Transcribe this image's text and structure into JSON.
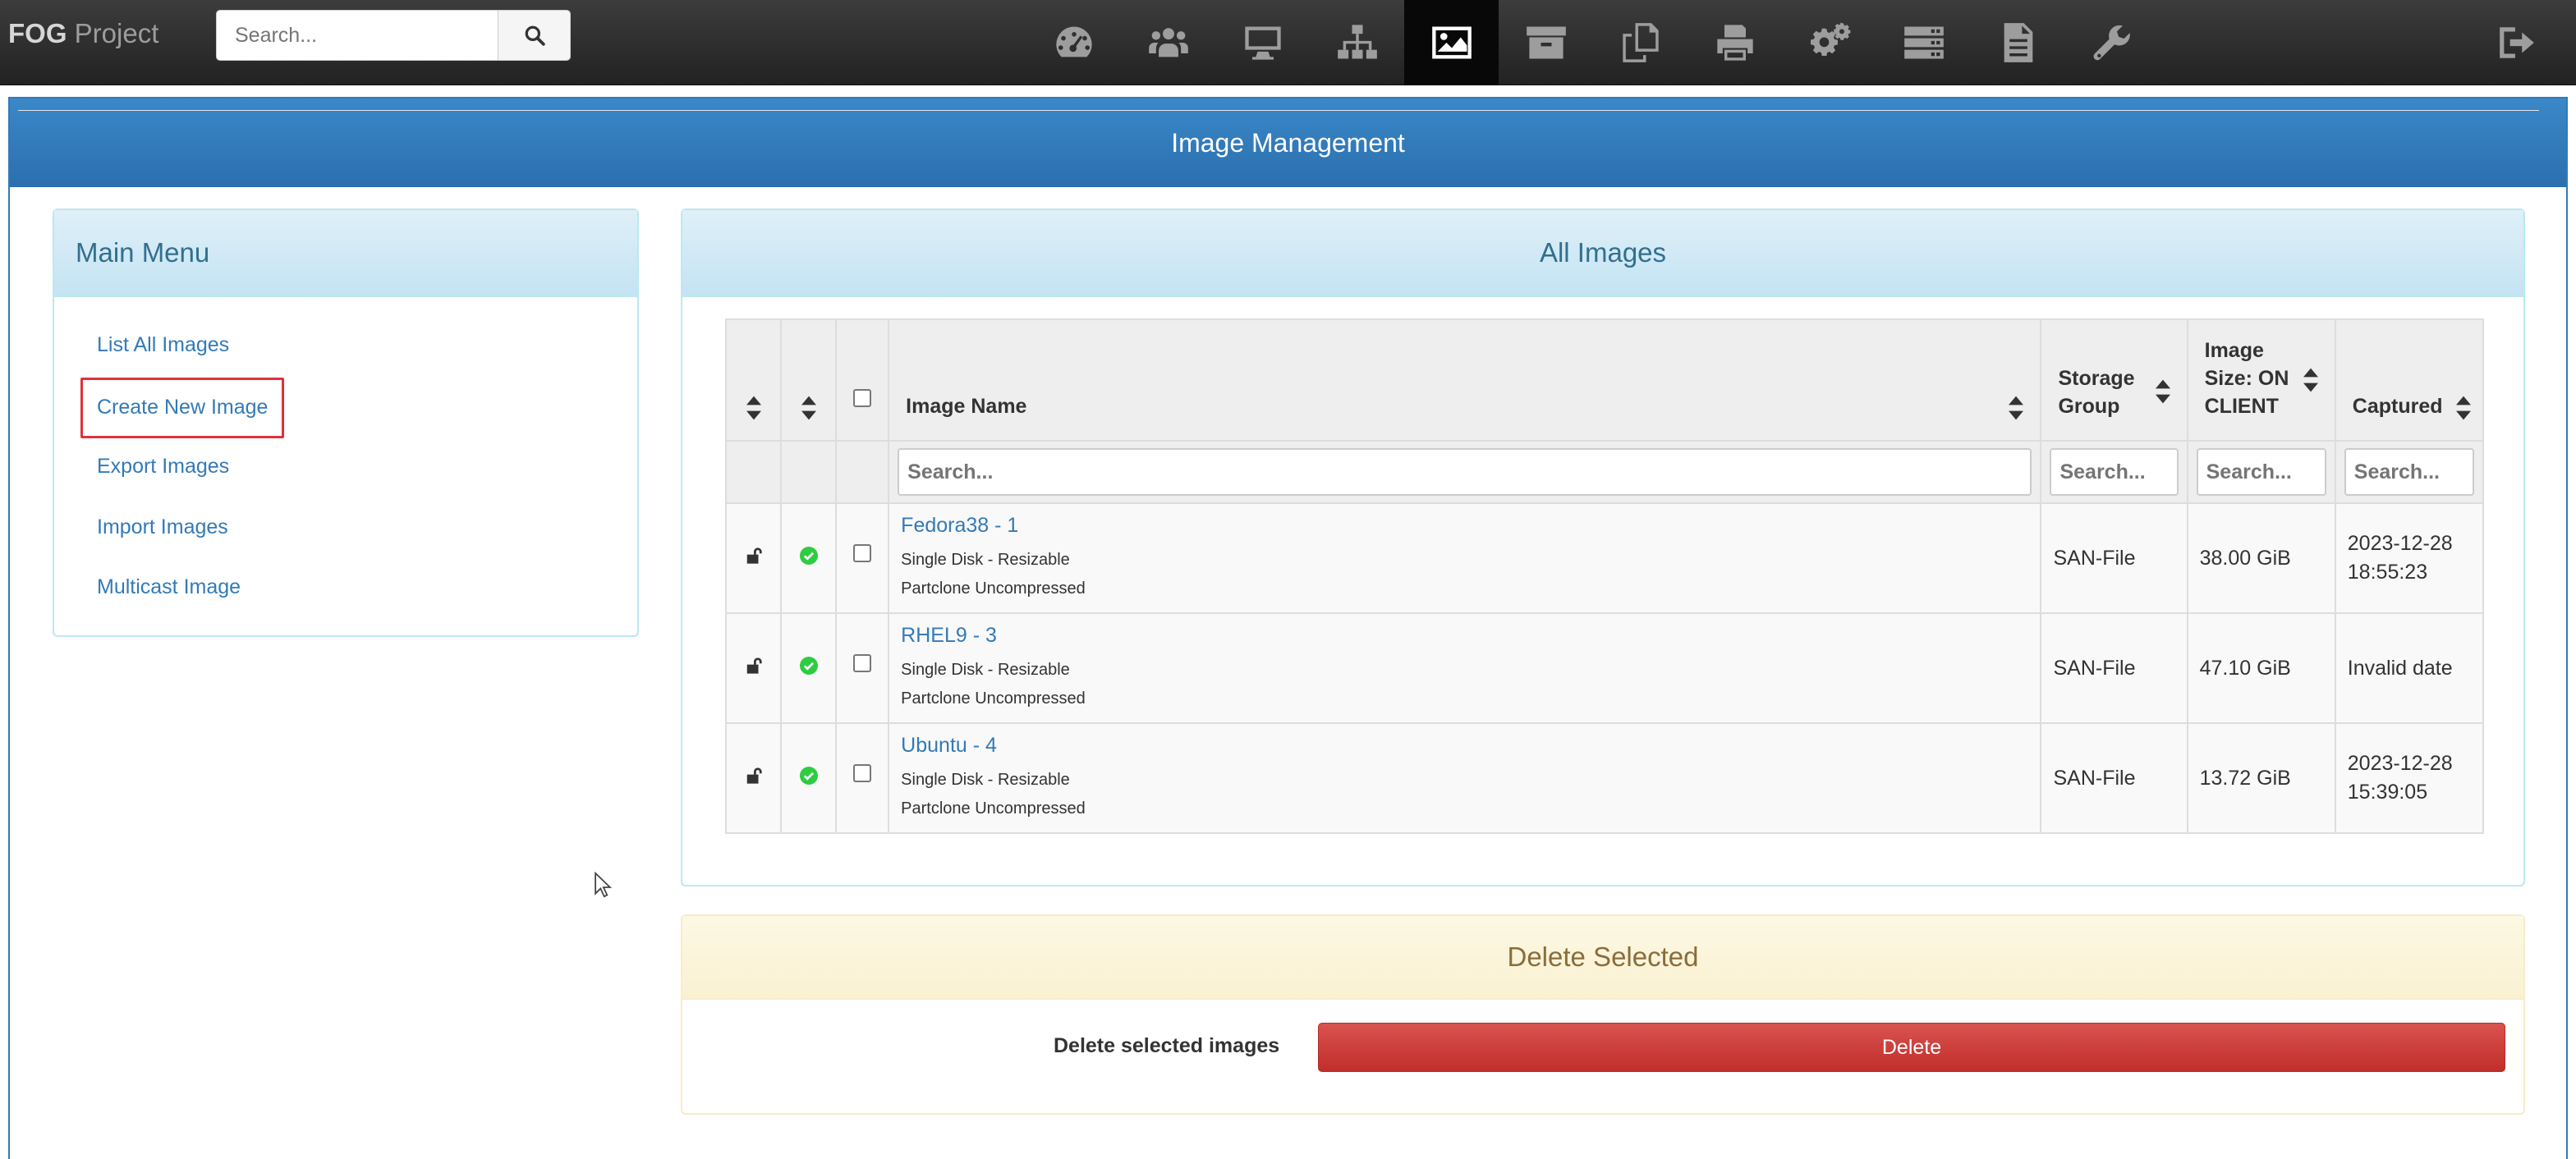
{
  "navbar": {
    "brand_bold": "FOG",
    "brand_rest": " Project",
    "search_placeholder": "Search...",
    "icons": [
      "dashboard-icon",
      "users-icon",
      "desktop-icon",
      "sitemap-icon",
      "image-icon",
      "archive-icon",
      "files-icon",
      "printer-icon",
      "gears-icon",
      "server-icon",
      "document-icon",
      "wrench-icon"
    ],
    "active_icon": "image-icon",
    "logout_icon": "sign-out-icon"
  },
  "page": {
    "title": "Image Management"
  },
  "menu": {
    "title": "Main Menu",
    "items": [
      "List All Images",
      "Create New Image",
      "Export Images",
      "Import Images",
      "Multicast Image"
    ],
    "highlighted": "Create New Image"
  },
  "images": {
    "title": "All Images",
    "columns": {
      "name": "Image Name",
      "storage": "Storage Group",
      "storage_l1": "Storage",
      "storage_l2": "Group",
      "size_l1": "Image",
      "size_l2": "Size: ON",
      "size_l3": "CLIENT",
      "captured": "Captured"
    },
    "filter_placeholder": "Search...",
    "rows": [
      {
        "name": "Fedora38 - 1",
        "type": "Single Disk - Resizable",
        "format": "Partclone Uncompressed",
        "storage": "SAN-File",
        "size": "38.00 GiB",
        "captured_l1": "2023-12-28",
        "captured_l2": "18:55:23"
      },
      {
        "name": "RHEL9 - 3",
        "type": "Single Disk - Resizable",
        "format": "Partclone Uncompressed",
        "storage": "SAN-File",
        "size": "47.10 GiB",
        "captured_l1": "Invalid date",
        "captured_l2": ""
      },
      {
        "name": "Ubuntu - 4",
        "type": "Single Disk - Resizable",
        "format": "Partclone Uncompressed",
        "storage": "SAN-File",
        "size": "13.72 GiB",
        "captured_l1": "2023-12-28",
        "captured_l2": "15:39:05"
      }
    ]
  },
  "delete": {
    "title": "Delete Selected",
    "label": "Delete selected images",
    "button": "Delete"
  },
  "colors": {
    "primary": "#337ab7",
    "danger": "#d9534f",
    "success": "#2ecc40",
    "warning_text": "#8a6d3b",
    "info_text": "#31708f"
  }
}
